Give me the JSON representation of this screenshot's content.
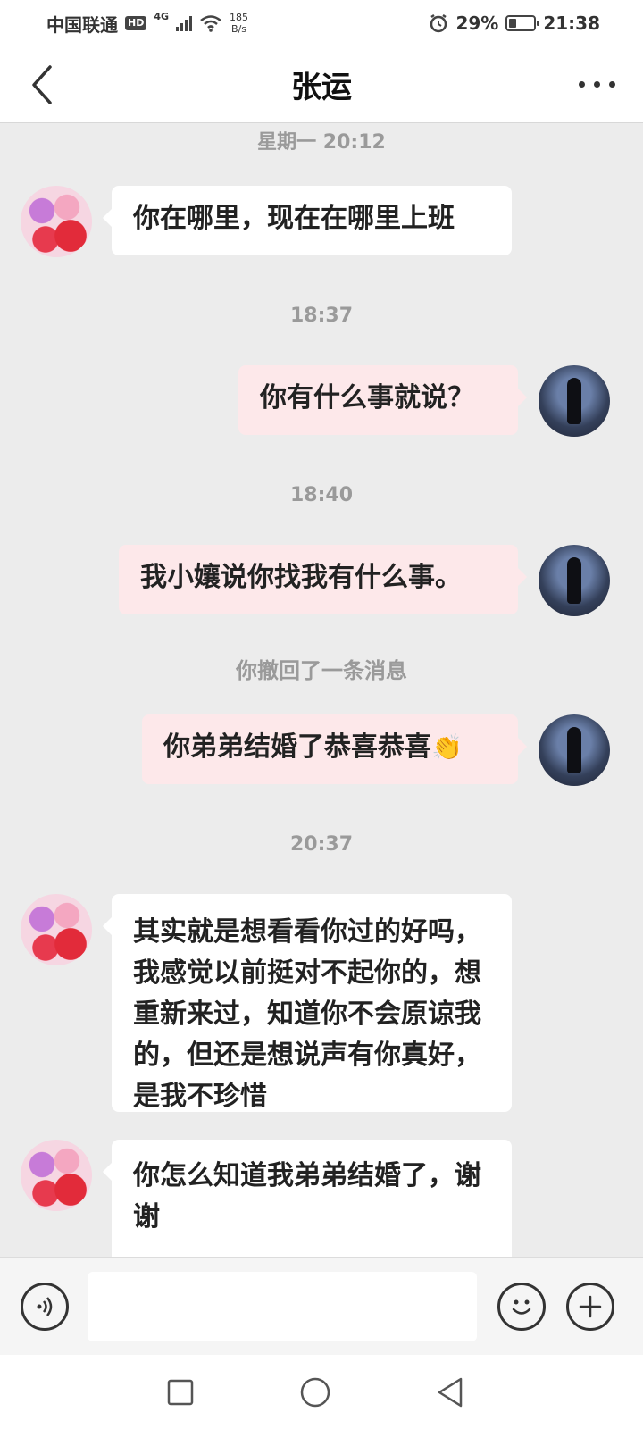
{
  "status_bar": {
    "carrier": "中国联通",
    "hd_badge": "HD",
    "network_type": "4G",
    "speed_value": "185",
    "speed_unit": "B/s",
    "battery": "29%",
    "battery_level": 0.29,
    "time": "21:38"
  },
  "header": {
    "title": "张运"
  },
  "chat": {
    "timestamps": [
      "星期一 20:12",
      "18:37",
      "18:40",
      "20:37"
    ],
    "recall_notice": "你撤回了一条消息",
    "messages": [
      {
        "sender": "other",
        "text": "你在哪里，现在在哪里上班"
      },
      {
        "sender": "self",
        "text": "你有什么事就说？"
      },
      {
        "sender": "self",
        "text": "我小孃说你找我有什么事。"
      },
      {
        "sender": "self",
        "text": "你弟弟结婚了恭喜恭喜",
        "emoji": "👏"
      },
      {
        "sender": "other",
        "text": "其实就是想看看你过的好吗，我感觉以前挺对不起你的，想重新来过，知道你不会原谅我的，但还是想说声有你真好，是我不珍惜"
      },
      {
        "sender": "other",
        "text": "你怎么知道我弟弟结婚了，谢谢"
      }
    ]
  },
  "input_bar": {
    "placeholder": "",
    "value": ""
  },
  "icons": {
    "back": "chevron-left-icon",
    "more": "more-dots-icon",
    "voice": "voice-icon",
    "emoji": "smiley-icon",
    "add": "plus-icon"
  }
}
